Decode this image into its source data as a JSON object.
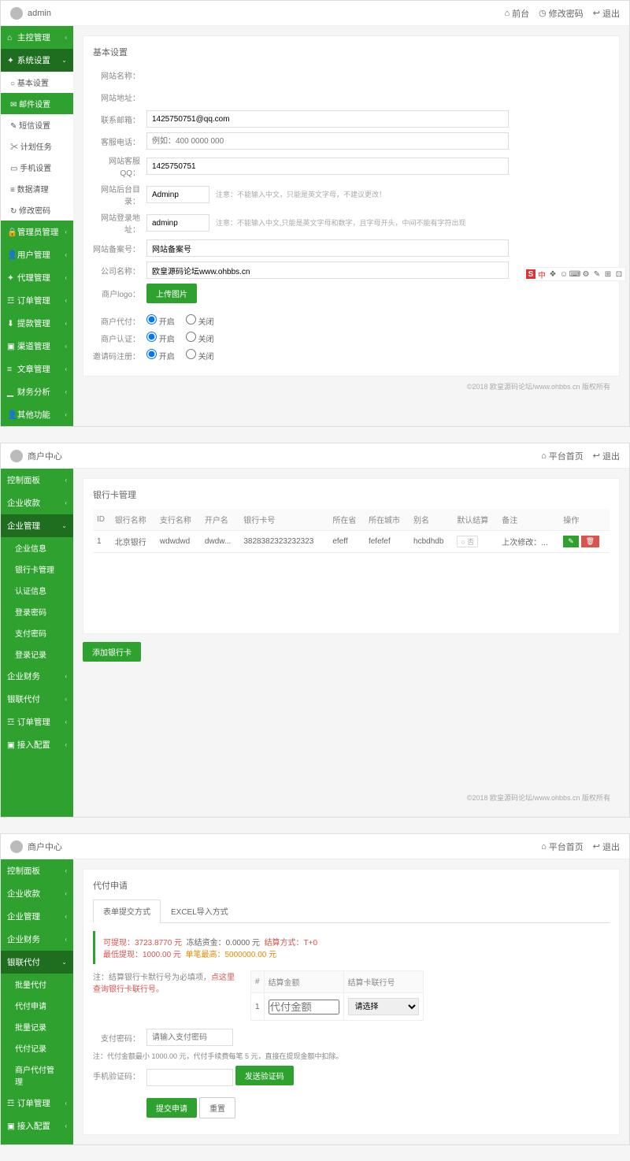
{
  "s1": {
    "topbar": {
      "user": "admin",
      "links": [
        "前台",
        "修改密码",
        "退出"
      ]
    },
    "sidebar": {
      "items": [
        {
          "label": "主控管理",
          "chev": true
        },
        {
          "label": "系统设置",
          "chev": true,
          "expanded": true
        },
        {
          "label": "管理员管理",
          "chev": true
        },
        {
          "label": "用户管理",
          "chev": true
        },
        {
          "label": "代理管理",
          "chev": true
        },
        {
          "label": "订单管理",
          "chev": true
        },
        {
          "label": "提款管理",
          "chev": true
        },
        {
          "label": "渠道管理",
          "chev": true
        },
        {
          "label": "文章管理",
          "chev": true
        },
        {
          "label": "财务分析",
          "chev": true
        },
        {
          "label": "其他功能",
          "chev": true
        }
      ],
      "subs": [
        "基本设置",
        "邮件设置",
        "短信设置",
        "计划任务",
        "手机设置",
        "数据清理",
        "修改密码"
      ]
    },
    "panel_title": "基本设置",
    "form": {
      "site_name": {
        "label": "网站名称：",
        "value": ""
      },
      "site_url": {
        "label": "网站地址：",
        "value": ""
      },
      "email": {
        "label": "联系邮箱：",
        "value": "1425750751@qq.com"
      },
      "phone": {
        "label": "客服电话：",
        "placeholder": "例如：400 0000 000"
      },
      "qq": {
        "label": "网站客服QQ：",
        "value": "1425750751"
      },
      "admin_dir": {
        "label": "网站后台目录：",
        "value": "Adminp",
        "hint": "注意：不能输入中文，只能是英文字母，不建议更改！"
      },
      "login_url": {
        "label": "网站登录地址：",
        "value": "adminp",
        "hint": "注意：不能输入中文,只能是英文字母和数字，且字母开头，中间不能有字符出现"
      },
      "beian": {
        "label": "网站备案号：",
        "value": "网站备案号"
      },
      "company": {
        "label": "公司名称：",
        "value": "欧皇源码论坛www.ohbbs.cn"
      },
      "logo": {
        "label": "商户logo：",
        "btn": "上传图片"
      },
      "merchant_pay": {
        "label": "商户代付：",
        "open": "开启",
        "close": "关闭"
      },
      "merchant_cert": {
        "label": "商户认证：",
        "open": "开启",
        "close": "关闭"
      },
      "invite_reg": {
        "label": "邀请码注册：",
        "open": "开启",
        "close": "关闭"
      }
    },
    "footer": "©2018 欧皇源码论坛/www.ohbbs.cn 版权所有",
    "ime": [
      "S",
      "中",
      "❖",
      "☺",
      "⌨",
      "⚙",
      "✎",
      "⊞",
      "⊡"
    ]
  },
  "s2": {
    "topbar": {
      "user": "商户中心",
      "links": [
        "平台首页",
        "退出"
      ]
    },
    "sidebar": {
      "items": [
        "控制面板",
        "企业收款",
        "企业管理",
        "企业财务",
        "银联代付",
        "订单管理",
        "接入配置"
      ],
      "subs": [
        "企业信息",
        "银行卡管理",
        "认证信息",
        "登录密码",
        "支付密码",
        "登录记录"
      ]
    },
    "panel_title": "银行卡管理",
    "table": {
      "headers": [
        "ID",
        "银行名称",
        "支行名称",
        "开户名",
        "银行卡号",
        "所在省",
        "所在城市",
        "别名",
        "默认结算",
        "备注",
        "操作"
      ],
      "row": [
        "1",
        "北京银行",
        "wdwdwd",
        "dwdw...",
        "3828382323232323",
        "efeff",
        "fefefef",
        "hcbdhdb",
        "",
        "上次修改：..."
      ],
      "default_badge": "否"
    },
    "add_btn": "添加银行卡",
    "footer": "©2018 欧皇源码论坛/www.ohbbs.cn 版权所有"
  },
  "s3": {
    "topbar": {
      "user": "商户中心",
      "links": [
        "平台首页",
        "退出"
      ]
    },
    "sidebar": {
      "items": [
        "控制面板",
        "企业收款",
        "企业管理",
        "企业财务",
        "银联代付",
        "订单管理",
        "接入配置"
      ],
      "subs": [
        "批量代付",
        "代付申请",
        "批量记录",
        "代付记录",
        "商户代付管理"
      ]
    },
    "panel_title": "代付申请",
    "tabs": [
      "表单提交方式",
      "EXCEL导入方式"
    ],
    "notice": {
      "l1a": "可提现：3723.8770 元",
      "l1b": "冻结资金：0.0000 元",
      "l1c": "结算方式：T+0",
      "l2a": "最低提现：1000.00 元",
      "l2b": "单笔最高：5000000.00 元"
    },
    "note1_pre": "注：结算银行卡默行号为必填项，",
    "note1_link": "点这里查询银行卡联行号。",
    "tbl": {
      "headers": [
        "#",
        "结算金额",
        "结算卡联行号"
      ],
      "row": [
        "1",
        "代付金额",
        "请选择"
      ]
    },
    "paypwd": {
      "label": "支付密码：",
      "placeholder": "请输入支付密码"
    },
    "note2": "注：代付金额最小 1000.00 元，代付手续费每笔 5 元，直接在提现金额中扣除。",
    "smscode": {
      "label": "手机验证码：",
      "btn": "发送验证码"
    },
    "submit": "提交申请",
    "reset": "重置"
  }
}
